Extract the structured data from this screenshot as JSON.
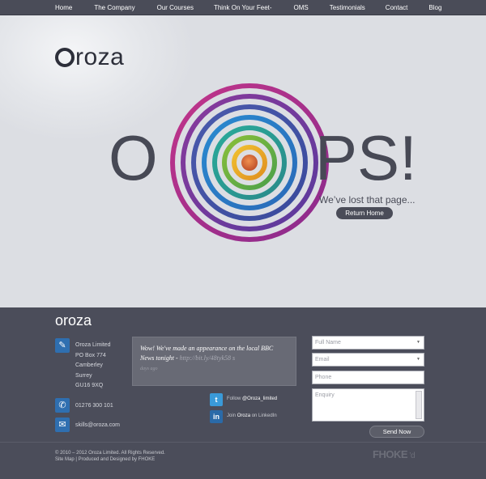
{
  "nav": {
    "items": [
      "Home",
      "The Company",
      "Our Courses",
      "Think On Your Feet-",
      "OMS",
      "Testimonials",
      "Contact",
      "Blog"
    ]
  },
  "hero": {
    "logo_text": "roza",
    "big_left": "O",
    "big_right": "PS!",
    "tagline": "We’ve lost that page...",
    "return_button": "Return Home"
  },
  "footer": {
    "logo_text": "oroza",
    "address": [
      "Oroza Limited",
      "PO Box 774",
      "Camberley",
      "Surrey",
      "GU16 9XQ"
    ],
    "phone": "01276 300 101",
    "email": "skills@oroza.com",
    "tweet": {
      "text": "Wow! We've made an appearance on the local BBC News tonight - ",
      "link": "http://bit.ly/48tyk58",
      "ago": "days ago"
    },
    "twitter": {
      "prefix": "Follow",
      "handle": "@Oroza_limited"
    },
    "linkedin": {
      "prefix": "Join",
      "name": "Oroza",
      "suffix": "on LinkedIn"
    },
    "form": {
      "full_name_placeholder": "Full Name",
      "email_placeholder": "Email",
      "phone_placeholder": "Phone",
      "enquiry_placeholder": "Enquiry",
      "send_label": "Send Now"
    },
    "copyright": "© 2010 – 2012 Oroza Limited. All Rights Reserved.",
    "links": "Site Map | Produced and Designed by FHOKE",
    "brand": "FHOKE"
  },
  "colors": {
    "nav_bg": "#4a4c58",
    "footer_bg": "#4b4d5a",
    "hero_bg": "#dfe1e6",
    "accent_blue": "#2f6fb0"
  }
}
